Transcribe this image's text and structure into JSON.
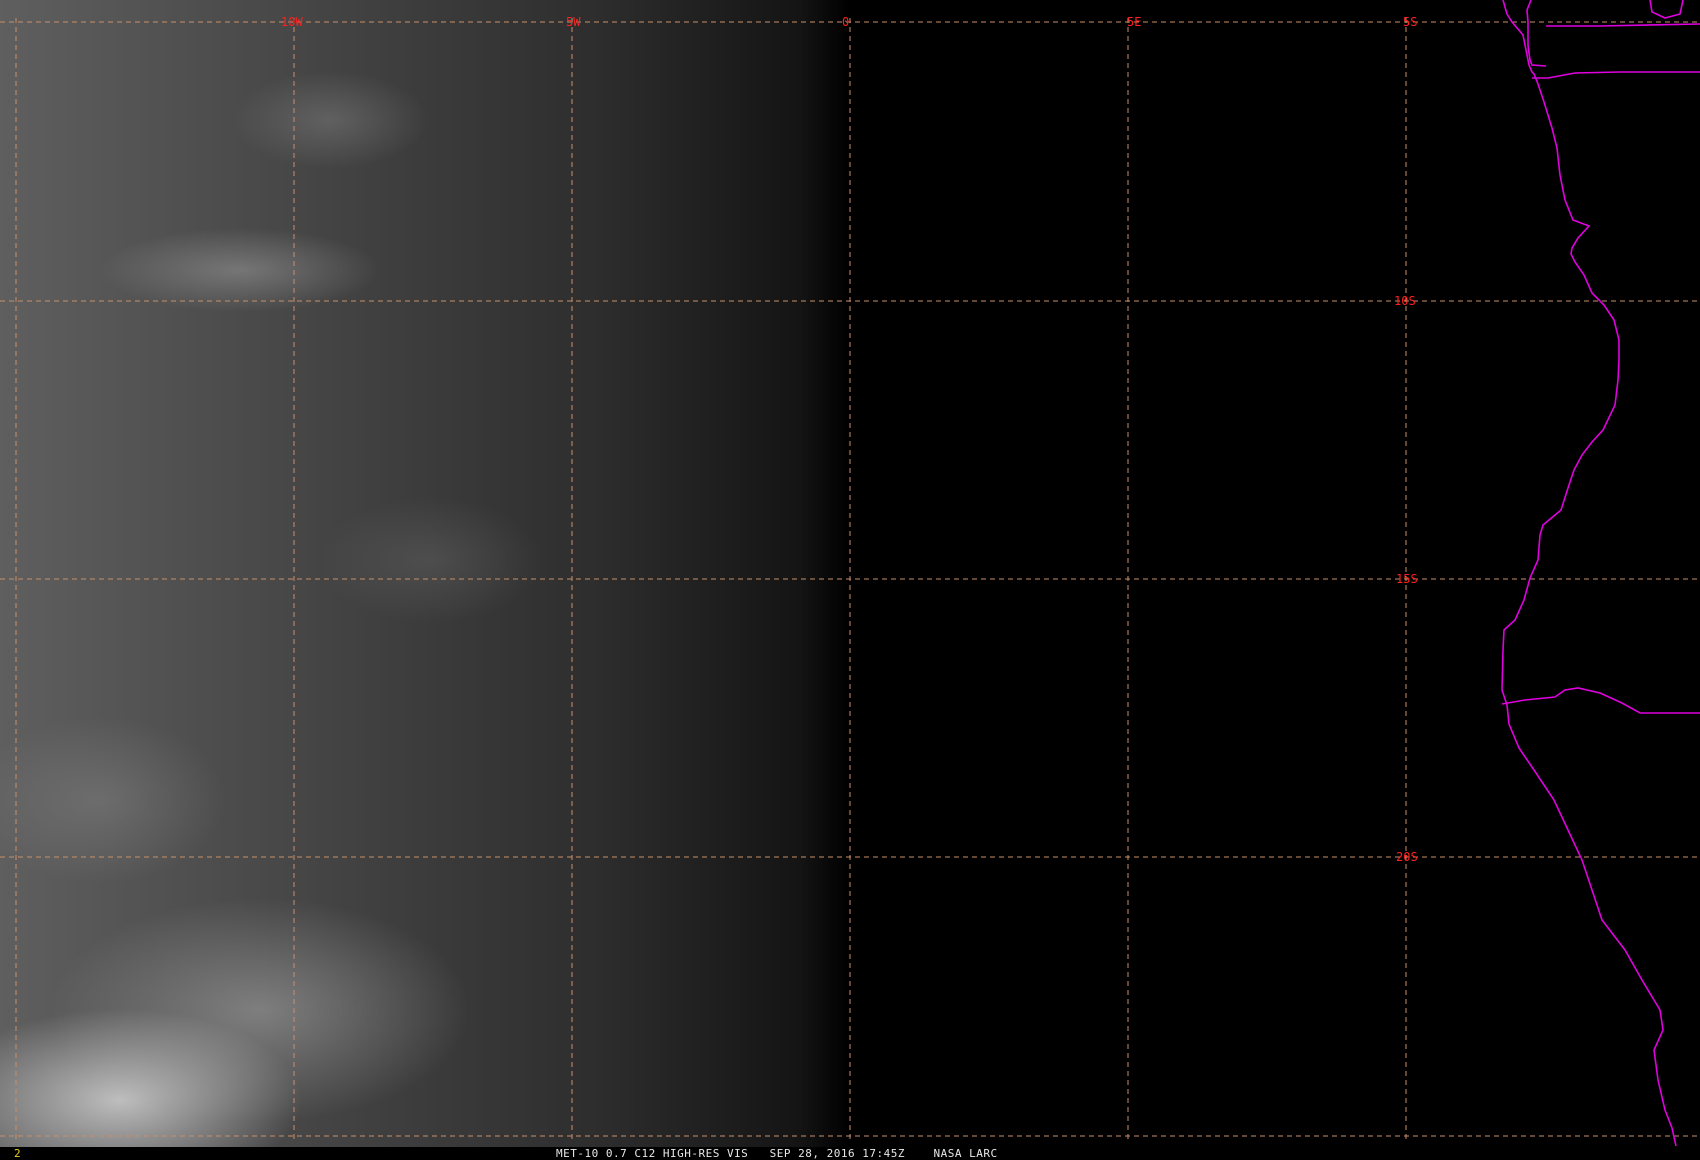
{
  "image": {
    "caption": "MET-10 0.7 C12 HIGH-RES VIS   SEP 28, 2016 17:45Z    NASA LARC",
    "frame_number": "2"
  },
  "grid": {
    "longitude_labels": [
      "10W",
      "5W",
      "0",
      "5E"
    ],
    "latitude_labels": [
      "5S",
      "10S",
      "15S",
      "20S"
    ]
  },
  "colors": {
    "grid": "#c8906a",
    "labels": "#ff2020",
    "coastline": "#e000e0",
    "caption": "#e8e8e8",
    "frame_number": "#e8d020"
  }
}
